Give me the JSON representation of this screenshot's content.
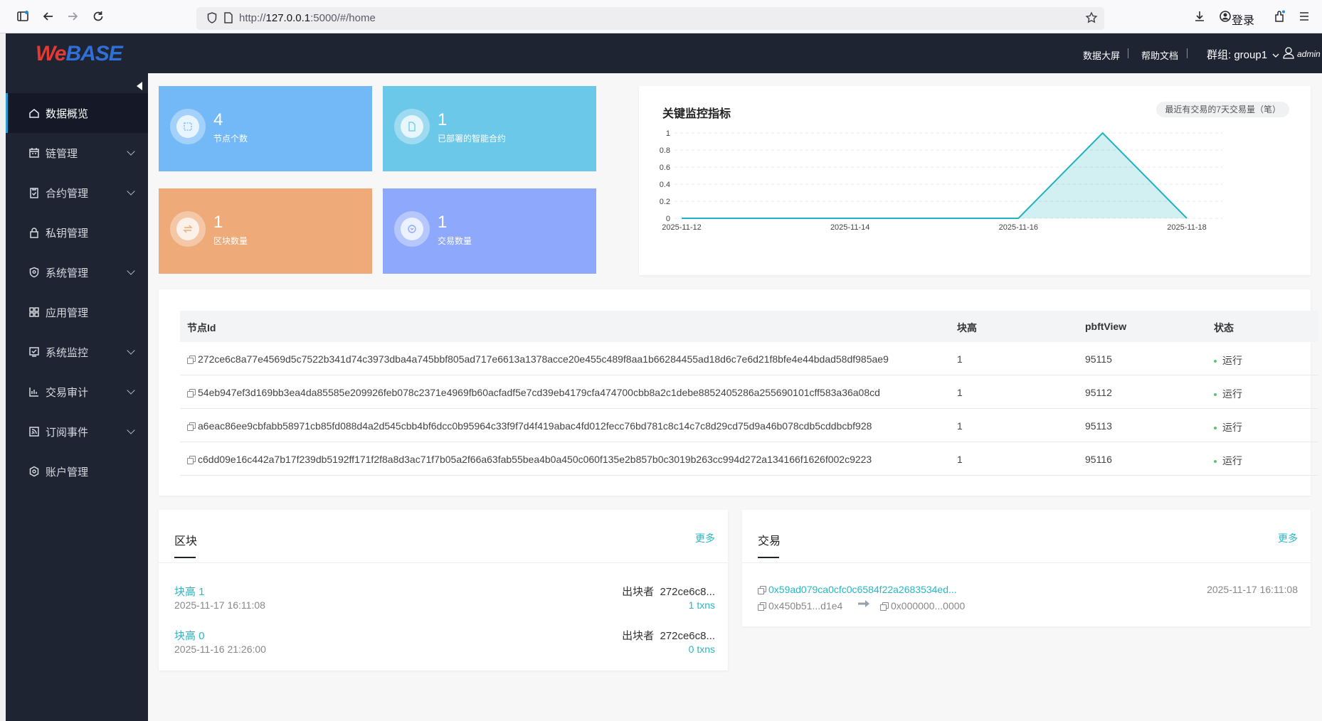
{
  "browser": {
    "url_prefix": "http://",
    "url_host": "127.0.0.1",
    "url_rest": ":5000/#/home",
    "login": "登录"
  },
  "header": {
    "logo_we": "We",
    "logo_base": "BASE",
    "data_screen": "数据大屏",
    "help_docs": "帮助文档",
    "group": "群组: group1",
    "user": "admin"
  },
  "sidebar": {
    "items": [
      {
        "label": "数据概览",
        "icon": "home-icon"
      },
      {
        "label": "链管理",
        "icon": "chain-icon"
      },
      {
        "label": "合约管理",
        "icon": "contract-icon"
      },
      {
        "label": "私钥管理",
        "icon": "lock-icon"
      },
      {
        "label": "系统管理",
        "icon": "shield-icon"
      },
      {
        "label": "应用管理",
        "icon": "apps-icon"
      },
      {
        "label": "系统监控",
        "icon": "monitor-icon"
      },
      {
        "label": "交易审计",
        "icon": "bar-chart-icon"
      },
      {
        "label": "订阅事件",
        "icon": "rss-icon"
      },
      {
        "label": "账户管理",
        "icon": "account-icon"
      }
    ]
  },
  "stats": [
    {
      "value": "4",
      "label": "节点个数",
      "color": "#73b8f7"
    },
    {
      "value": "1",
      "label": "已部署的智能合约",
      "color": "#6cc8e8"
    },
    {
      "value": "1",
      "label": "区块数量",
      "color": "#eeaa78"
    },
    {
      "value": "1",
      "label": "交易数量",
      "color": "#8ea9fc"
    }
  ],
  "chart_header": {
    "title": "关键监控指标",
    "badge": "最近有交易的7天交易量（笔）"
  },
  "chart_data": {
    "type": "area",
    "x": [
      "2025-11-12",
      "2025-11-13",
      "2025-11-14",
      "2025-11-15",
      "2025-11-16",
      "2025-11-17",
      "2025-11-18"
    ],
    "x_ticks": [
      "2025-11-12",
      "2025-11-14",
      "2025-11-16",
      "2025-11-18"
    ],
    "values": [
      0,
      0,
      0,
      0,
      0,
      1,
      0
    ],
    "y_ticks": [
      "1",
      "0.8",
      "0.6",
      "0.4",
      "0.2",
      "0"
    ],
    "ylim": [
      0,
      1
    ],
    "grid": true,
    "color": "#1fb3bf"
  },
  "node_table": {
    "headers": [
      "节点Id",
      "块高",
      "pbftView",
      "状态"
    ],
    "rows": [
      {
        "id": "272ce6c8a77e4569d5c7522b341d74c3973dba4a745bbf805ad717e6613a1378acce20e455c489f8aa1b66284455ad18d6c7e6d21f8bfe4e44bdad58df985ae9",
        "height": "1",
        "view": "95115",
        "status": "运行"
      },
      {
        "id": "54eb947ef3d169bb3ea4da85585e209926feb078c2371e4969fb60acfadf5e7cd39eb4179cfa474700cbb8a2c1debe8852405286a255690101cff583a36a08cd",
        "height": "1",
        "view": "95112",
        "status": "运行"
      },
      {
        "id": "a6eac86ee9cbfabb58971cb85fd088d4a2d545cbb4bf6dcc0b95964c33f9f7d4f419abac4fd012fecc76bd781c8c14c7c8d29cd75d9a46b078cdb5cddbcbf928",
        "height": "1",
        "view": "95113",
        "status": "运行"
      },
      {
        "id": "c6dd09e16c442a7b17f239db5192ff171f2f8a8d3ac71f7b05a2f66a63fab55bea4b0a450c060f135e2b857b0c3019b263cc994d272a134166f1626f002c9223",
        "height": "1",
        "view": "95116",
        "status": "运行"
      }
    ]
  },
  "blocks": {
    "title": "区块",
    "more": "更多",
    "items": [
      {
        "label": "块高 1",
        "time": "2025-11-17 16:11:08",
        "miner_label": "出块者",
        "miner": "272ce6c8...",
        "txns": "1 txns"
      },
      {
        "label": "块高 0",
        "time": "2025-11-16 21:26:00",
        "miner_label": "出块者",
        "miner": "272ce6c8...",
        "txns": "0 txns"
      }
    ]
  },
  "transactions": {
    "title": "交易",
    "more": "更多",
    "items": [
      {
        "hash": "0x59ad079ca0cfc0c6584f22a2683534ed...",
        "time": "2025-11-17 16:11:08",
        "from": "0x450b51...d1e4",
        "to": "0x000000...0000"
      }
    ]
  }
}
